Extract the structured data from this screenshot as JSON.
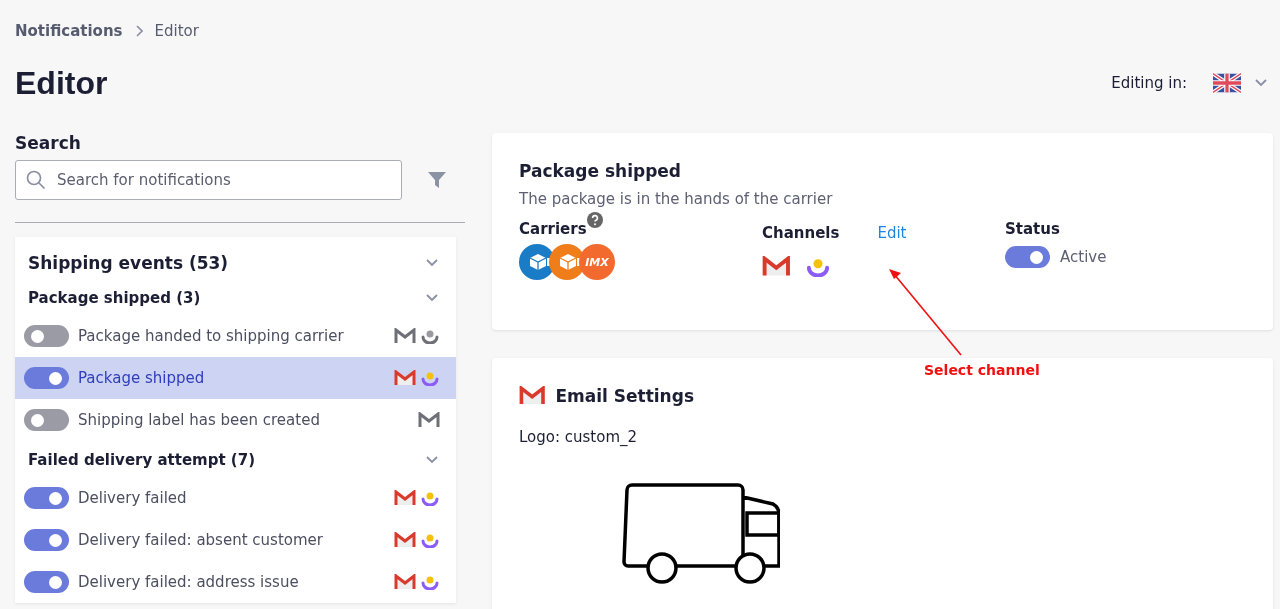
{
  "breadcrumb": [
    {
      "label": "Notifications"
    },
    {
      "label": "Editor"
    }
  ],
  "title": "Editor",
  "language": {
    "label": "Editing in:"
  },
  "search": {
    "label": "Search",
    "placeholder": "Search for notifications"
  },
  "sidebar": {
    "title": "Shipping events (53)",
    "expanded": true,
    "groups": [
      {
        "title": "Package shipped (3)",
        "expanded": true,
        "items": [
          {
            "label": "Package handed to shipping carrier",
            "on": false,
            "selected": false,
            "channels": [
              {
                "kind": "email",
                "active": false
              },
              {
                "kind": "chat",
                "active": false
              }
            ]
          },
          {
            "label": "Package shipped",
            "on": true,
            "selected": true,
            "channels": [
              {
                "kind": "email",
                "active": true
              },
              {
                "kind": "chat",
                "active": true
              }
            ]
          },
          {
            "label": "Shipping label has been created",
            "on": false,
            "selected": false,
            "channels": [
              {
                "kind": "email",
                "active": false
              }
            ]
          }
        ]
      },
      {
        "title": "Failed delivery attempt (7)",
        "expanded": true,
        "items": [
          {
            "label": "Delivery failed",
            "on": true,
            "selected": false,
            "channels": [
              {
                "kind": "email",
                "active": true
              },
              {
                "kind": "chat",
                "active": true
              }
            ]
          },
          {
            "label": "Delivery failed: absent customer",
            "on": true,
            "selected": false,
            "channels": [
              {
                "kind": "email",
                "active": true
              },
              {
                "kind": "chat",
                "active": true
              }
            ]
          },
          {
            "label": "Delivery failed: address issue",
            "on": true,
            "selected": false,
            "channels": [
              {
                "kind": "email",
                "active": true
              },
              {
                "kind": "chat",
                "active": true
              }
            ]
          }
        ]
      }
    ]
  },
  "detail": {
    "title": "Package shipped",
    "description": "The package is in the hands of the carrier",
    "carriers_label": "Carriers",
    "carriers": [
      {
        "kind": "box",
        "color": "#1a7bc6"
      },
      {
        "kind": "box",
        "color": "#ef7d1a"
      },
      {
        "kind": "text",
        "label": "IMX",
        "color": "#f26a2e"
      }
    ],
    "channels_label": "Channels",
    "edit": "Edit",
    "channels": [
      {
        "kind": "email",
        "active": true
      },
      {
        "kind": "chat",
        "active": true
      }
    ],
    "status_label": "Status",
    "status": {
      "on": true,
      "label": "Active"
    }
  },
  "email_settings": {
    "title": "Email Settings",
    "logo": "Logo: custom_2"
  },
  "annotation": {
    "label": "Select channel"
  }
}
